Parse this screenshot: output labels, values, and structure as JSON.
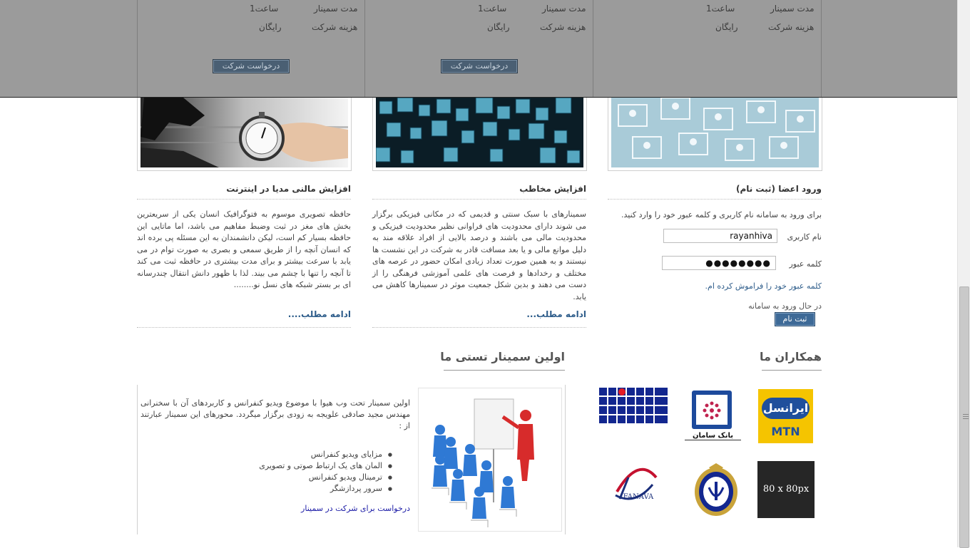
{
  "seminars_overlay": {
    "duration_label": "مدت سمینار",
    "duration_value": "1ساعت",
    "cost_label": "هزینه شرکت",
    "cost_value": "رایگان",
    "request_button": "درخواست شرکت"
  },
  "columns": {
    "media": {
      "title": "افزایش مالنی مدیا در اینترنت",
      "body": "حافظه تصویری موسوم به فتوگرافیک انسان یکی از سریعترین بخش های مغز در ثبت وضبط مفاهیم می باشد، اما ماتایی این حافظه بسیار کم است، لیکن دانشمندان به این مسئله پی برده اند که انسان آنچه را از طریق سمعی و بصری به صورت توام در می یابد با سرعت بیشتر و برای مدت بیشتری در حافظه ثبت می کند تا آنچه را تنها با چشم می بیند. لذا با ظهور دانش انتقال چندرسانه ای بر بستر شبکه های نسل نو........",
      "more": "ادامه مطلب...."
    },
    "audience": {
      "title": "افزایش مخاطب",
      "body": "سمینارهای با سبک سنتی و قدیمی که در مکانی فیزیکی برگزار می شوند دارای محدودیت های فراوانی نظیر محدودیت فیزیکی و محدودیت مالی می باشند و درصد بالایی از افراد علاقه مند به دلیل موانع مالی و یا بعد مسافت قادر به شرکت در این نشست ها نیستند و به همین صورت تعداد زیادی امکان حضور در عرصه های مختلف و رخدادها و فرصت های علمی آموزشی فرهنگی را از دست می دهند و بدین شکل جمعیت موثر در سمینارها کاهش می یابد.",
      "more": "ادامه مطلب..."
    },
    "login": {
      "title": "ورود اعضا (ثبت نام)",
      "intro": "برای ورود به سامانه نام کاربری و کلمه عبور خود را وارد کنید.",
      "username_label": "نام کاربری",
      "username_value": "rayanhiva",
      "password_label": "کلمه عبور",
      "password_value": "●●●●●●●●",
      "forgot": "کلمه عبور خود را فراموش کرده ام.",
      "status": "در حال ورود به سامانه",
      "register_button": "ثبت نام"
    }
  },
  "first_seminar": {
    "heading": "اولین سمینار تستی ما",
    "intro": "اولین سمینار تحت وب هیوا با موضوع ویدیو کنفرانس و کاربردهای آن با سخنرانی مهندس مجید صادقی علویجه به زودی برگزار میگردد. محورهای این سمینار عبارتند از :",
    "topics": [
      "مزایای ویدیو کنفرانس",
      "المان های یک ارتباط صوتی و تصویری",
      "ترمینال ویدیو کنفرانس",
      "سرور پردازشگر"
    ],
    "link": "درخواست برای شرکت در سمینار"
  },
  "partners": {
    "heading": "همکاران ما",
    "logos": {
      "irancell_text": "ایرانسل",
      "mtn_text": "MTN",
      "saman_text": "بانک سامان",
      "fanava_text": "FANAVA",
      "placeholder_text": "80 x 80px"
    },
    "colors": {
      "irancell_yellow": "#f5c400",
      "irancell_blue": "#1f4f9c",
      "saman_blue": "#1d4a9c",
      "navy": "#13278f",
      "dark_tile": "#262626"
    }
  }
}
